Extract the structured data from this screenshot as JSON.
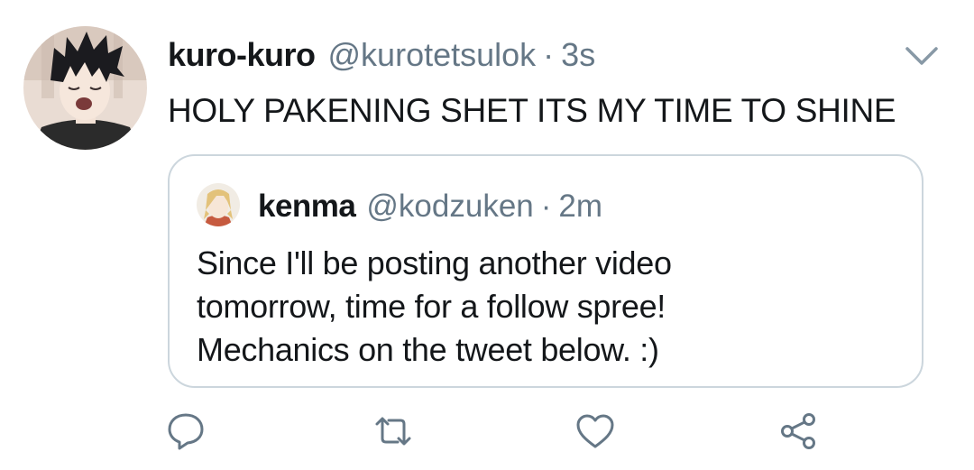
{
  "tweet": {
    "author": {
      "display_name": "kuro-kuro",
      "handle": "@kurotetsulok",
      "avatar": "avatar-black-haired-character"
    },
    "separator": "·",
    "time": "3s",
    "text": "HOLY PAKENING SHET ITS MY TIME TO SHINE",
    "menu_icon": "chevron-down-icon",
    "quoted": {
      "author": {
        "display_name": "kenma",
        "handle": "@kodzuken",
        "avatar": "avatar-blond-haired-character"
      },
      "separator": "·",
      "time": "2m",
      "lines": [
        "Since I'll be posting another video",
        "tomorrow, time for a follow spree!",
        "Mechanics on the tweet below. :)"
      ]
    },
    "actions": [
      {
        "icon": "reply-icon"
      },
      {
        "icon": "retweet-icon"
      },
      {
        "icon": "like-icon"
      },
      {
        "icon": "share-icon"
      }
    ]
  },
  "colors": {
    "text": "#14171a",
    "secondary": "#657786",
    "border": "#ccd6dd",
    "icon": "#657786"
  }
}
